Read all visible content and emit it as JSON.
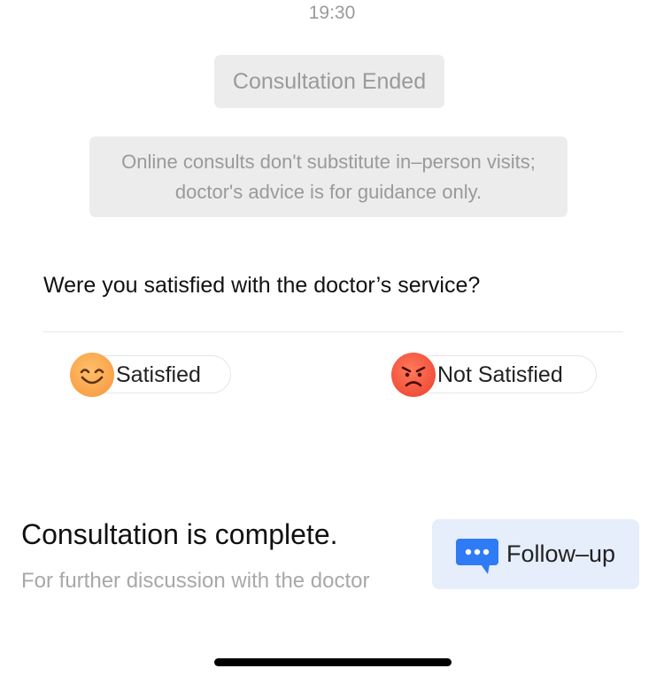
{
  "chat": {
    "timestamp": "19:30",
    "status_label": "Consultation Ended",
    "notice_lines": [
      "Online consults don't substitute in–person visits;",
      "doctor's advice is for guidance only."
    ]
  },
  "survey": {
    "question": "Were you satisfied with the doctor’s service?",
    "options": [
      {
        "label": "Satisfied",
        "icon": "smiling-face-icon",
        "color": "#f9a24a"
      },
      {
        "label": "Not Satisfied",
        "icon": "angry-face-icon",
        "color": "#f2503b"
      }
    ]
  },
  "footer": {
    "title": "Consultation is complete.",
    "subtitle": "For further discussion with the doctor",
    "followup_label": "Follow–up",
    "followup_icon": "chat-bubble-icon",
    "accent": "#2f7bf5"
  }
}
